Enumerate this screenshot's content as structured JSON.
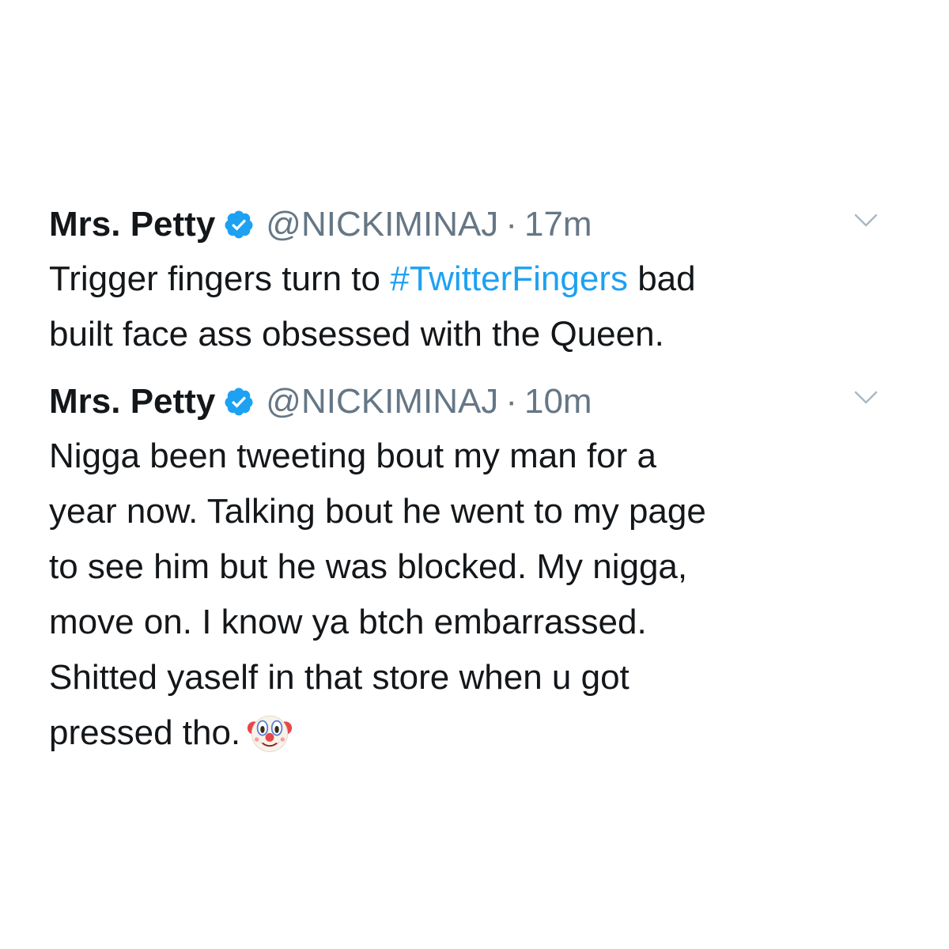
{
  "tweets": [
    {
      "display_name": "Mrs. Petty",
      "handle": "@NICKIMINAJ",
      "separator": "·",
      "time": "17m",
      "verified_icon": "verified-badge-icon",
      "menu_icon": "chevron-down-icon",
      "lines": [
        {
          "before": "Trigger fingers turn to ",
          "hashtag": "#TwitterFingers",
          "after": " bad"
        },
        {
          "text": "built face ass obsessed with the Queen."
        }
      ]
    },
    {
      "display_name": "Mrs. Petty",
      "handle": "@NICKIMINAJ",
      "separator": "·",
      "time": "10m",
      "verified_icon": "verified-badge-icon",
      "menu_icon": "chevron-down-icon",
      "lines": [
        {
          "text": "Nigga been tweeting bout my man for a"
        },
        {
          "text": "year now. Talking bout he went to my page"
        },
        {
          "text": "to see him but he was blocked. My nigga,"
        },
        {
          "text": "move on. I know ya btch embarrassed."
        },
        {
          "text": "Shitted yaself in that store when u got"
        },
        {
          "text": "pressed tho.",
          "emoji": "clown-face-icon"
        }
      ]
    }
  ],
  "colors": {
    "text": "#14171a",
    "secondary": "#657786",
    "link": "#1da1f2",
    "verified": "#1da1f2",
    "chevron": "#aab8c2"
  }
}
